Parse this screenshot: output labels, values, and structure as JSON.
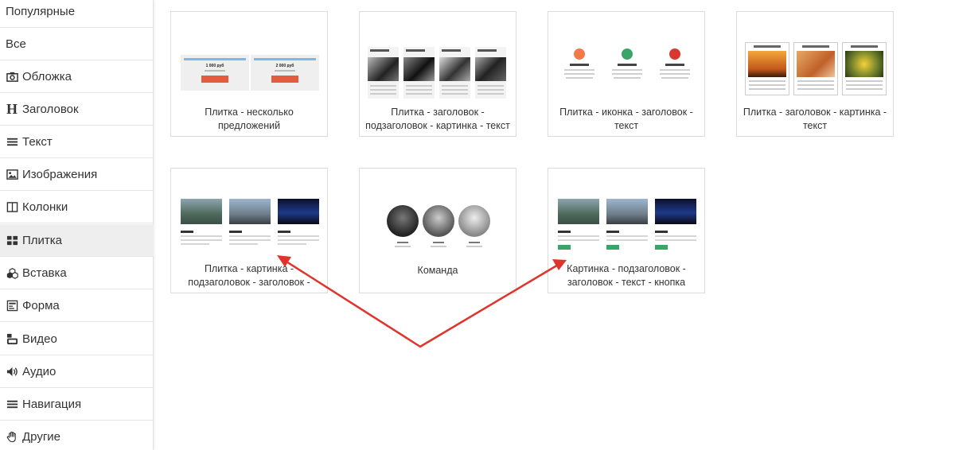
{
  "sidebar": {
    "items": [
      {
        "label": "Популярные",
        "icon": ""
      },
      {
        "label": "Все",
        "icon": ""
      },
      {
        "label": "Обложка",
        "icon": "camera-icon"
      },
      {
        "label": "Заголовок",
        "icon": "heading-icon"
      },
      {
        "label": "Текст",
        "icon": "text-lines-icon"
      },
      {
        "label": "Изображения",
        "icon": "image-icon"
      },
      {
        "label": "Колонки",
        "icon": "columns-icon"
      },
      {
        "label": "Плитка",
        "icon": "tiles-icon",
        "active": true
      },
      {
        "label": "Вставка",
        "icon": "cubes-icon"
      },
      {
        "label": "Форма",
        "icon": "form-icon"
      },
      {
        "label": "Видео",
        "icon": "youtube-icon"
      },
      {
        "label": "Аудио",
        "icon": "volume-icon"
      },
      {
        "label": "Навигация",
        "icon": "menu-icon"
      },
      {
        "label": "Другие",
        "icon": "hand-icon"
      }
    ],
    "heading_glyph": "H"
  },
  "cards": [
    {
      "label": "Плитка - несколько предложений",
      "thumb": {
        "prices": [
          "1 000 руб",
          "2 000 руб"
        ]
      }
    },
    {
      "label": "Плитка - заголовок - подзаголовок - картинка - текст"
    },
    {
      "label": "Плитка - иконка - заголовок - текст"
    },
    {
      "label": "Плитка - заголовок - картинка - текст"
    },
    {
      "label": "Плитка - картинка - подзаголовок - заголовок -"
    },
    {
      "label": "Команда"
    },
    {
      "label": "Картинка - подзаголовок - заголовок - текст - кнопка"
    }
  ],
  "colors": {
    "active_bg": "#eeeeee",
    "arrow": "#e0332b",
    "offer_button": "#e35c3e",
    "icon_orange": "#f07a4a",
    "icon_green": "#3aa56a",
    "icon_red": "#d9382f"
  }
}
